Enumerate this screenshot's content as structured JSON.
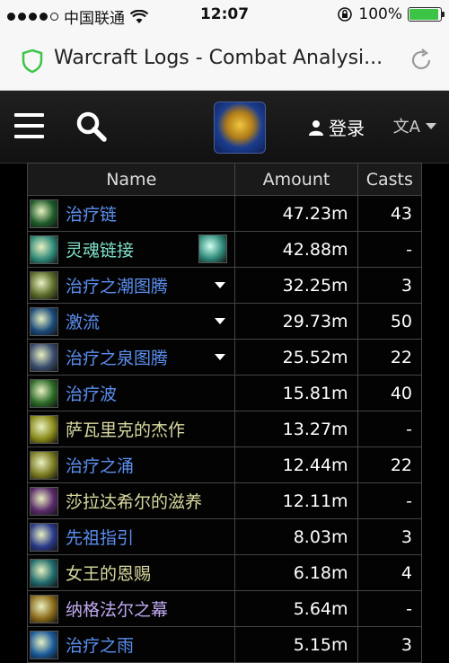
{
  "status_bar": {
    "carrier": "中国联通",
    "time": "12:07",
    "battery": "100%"
  },
  "browser": {
    "page_title": "Warcraft Logs - Combat Analysi..."
  },
  "nav": {
    "login_label": "登录",
    "lang_label": "文A"
  },
  "table": {
    "headers": [
      "Name",
      "Amount",
      "Casts"
    ],
    "rows": [
      {
        "name": "治疗链",
        "amount": "47.23m",
        "casts": "43",
        "color": "#5b8ff0",
        "icon_bg": "#1f5c2b",
        "icon": "chain-heal-icon",
        "caret": false,
        "sub_icon": false
      },
      {
        "name": "灵魂链接",
        "amount": "42.88m",
        "casts": "-",
        "color": "#7fe0c8",
        "icon_bg": "#2f8a7a",
        "icon": "spirit-link-icon",
        "caret": false,
        "sub_icon": true
      },
      {
        "name": "治疗之潮图腾",
        "amount": "32.25m",
        "casts": "3",
        "color": "#5b8ff0",
        "icon_bg": "#5a6b2a",
        "icon": "healing-tide-totem-icon",
        "caret": true,
        "sub_icon": false
      },
      {
        "name": "激流",
        "amount": "29.73m",
        "casts": "50",
        "color": "#5b8ff0",
        "icon_bg": "#1b4a7a",
        "icon": "riptide-icon",
        "caret": true,
        "sub_icon": false
      },
      {
        "name": "治疗之泉图腾",
        "amount": "25.52m",
        "casts": "22",
        "color": "#5b8ff0",
        "icon_bg": "#3a4d6e",
        "icon": "healing-stream-totem-icon",
        "caret": true,
        "sub_icon": false
      },
      {
        "name": "治疗波",
        "amount": "15.81m",
        "casts": "40",
        "color": "#5b8ff0",
        "icon_bg": "#2b6b28",
        "icon": "healing-wave-icon",
        "caret": false,
        "sub_icon": false
      },
      {
        "name": "萨瓦里克的杰作",
        "amount": "13.27m",
        "casts": "-",
        "color": "#d9d9a0",
        "icon_bg": "#8a8a1a",
        "icon": "trinket-icon",
        "caret": false,
        "sub_icon": false
      },
      {
        "name": "治疗之涌",
        "amount": "12.44m",
        "casts": "22",
        "color": "#5b8ff0",
        "icon_bg": "#7a7a20",
        "icon": "healing-surge-icon",
        "caret": false,
        "sub_icon": false
      },
      {
        "name": "莎拉达希尔的滋养",
        "amount": "12.11m",
        "casts": "-",
        "color": "#d9d9a0",
        "icon_bg": "#5a2a6a",
        "icon": "nourish-icon",
        "caret": false,
        "sub_icon": false
      },
      {
        "name": "先祖指引",
        "amount": "8.03m",
        "casts": "3",
        "color": "#5b8ff0",
        "icon_bg": "#2a3a8a",
        "icon": "ancestral-guidance-icon",
        "caret": false,
        "sub_icon": false
      },
      {
        "name": "女王的恩赐",
        "amount": "6.18m",
        "casts": "4",
        "color": "#d9d9a0",
        "icon_bg": "#1f6b6b",
        "icon": "queens-grace-icon",
        "caret": false,
        "sub_icon": false
      },
      {
        "name": "纳格法尔之幕",
        "amount": "5.64m",
        "casts": "-",
        "color": "#c0a8f0",
        "icon_bg": "#8a6a1a",
        "icon": "naglfar-shroud-icon",
        "caret": false,
        "sub_icon": false
      },
      {
        "name": "治疗之雨",
        "amount": "5.15m",
        "casts": "3",
        "color": "#5b8ff0",
        "icon_bg": "#1a5a9a",
        "icon": "healing-rain-icon",
        "caret": false,
        "sub_icon": false
      }
    ]
  }
}
